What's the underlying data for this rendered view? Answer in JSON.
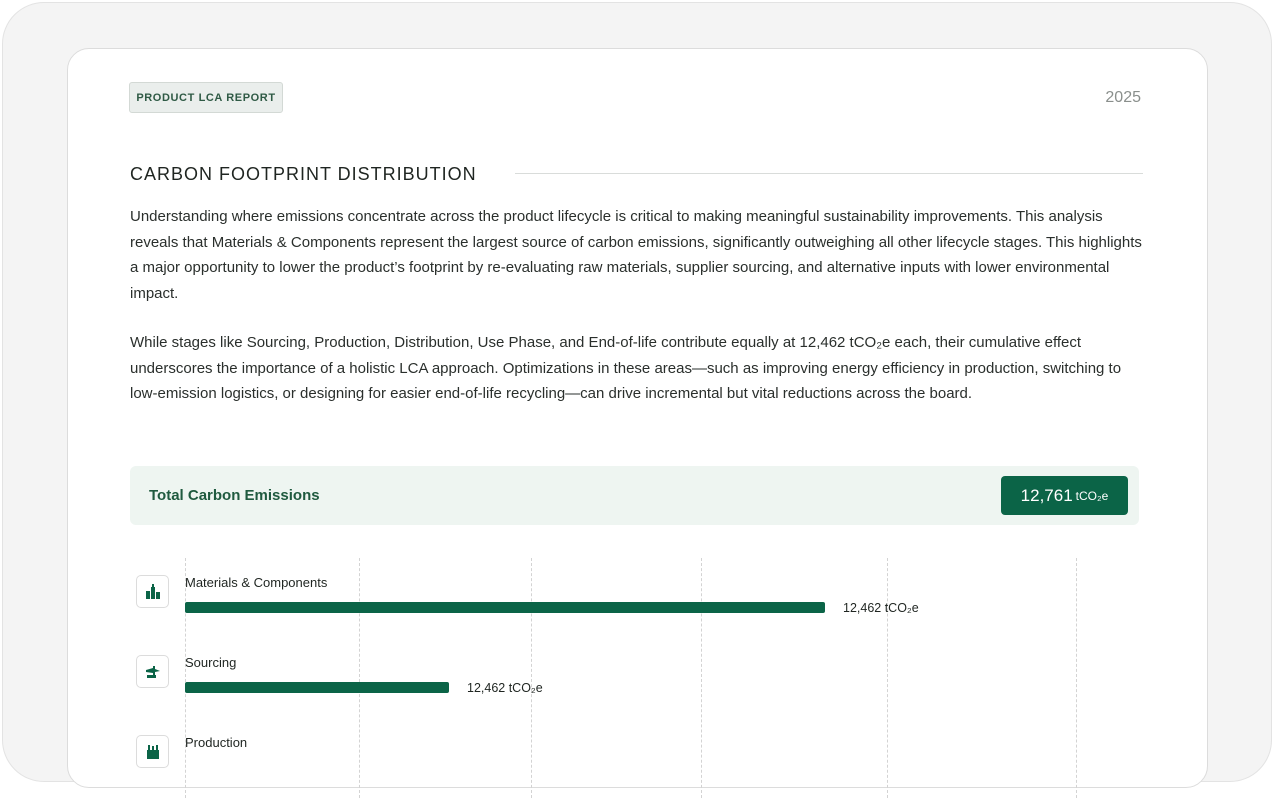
{
  "header": {
    "badge": "PRODUCT LCA REPORT",
    "year": "2025"
  },
  "section": {
    "title": "CARBON FOOTPRINT DISTRIBUTION",
    "paragraphs": [
      "Understanding where emissions concentrate across the product lifecycle is critical to making meaningful sustainability improvements. This analysis reveals that Materials & Components represent the largest source of carbon emissions, significantly outweighing all other lifecycle stages. This highlights a major opportunity to lower the product’s footprint by re-evaluating raw materials, supplier sourcing, and alternative inputs with lower environmental impact.",
      "While stages like Sourcing, Production, Distribution, Use Phase, and End-of-life contribute equally at 12,462 tCO₂e each, their cumulative effect underscores the importance of a holistic LCA approach. Optimizations in these areas—such as improving energy efficiency in production, switching to low-emission logistics, or designing for easier end-of-life recycling—can drive incremental but vital reductions across the board."
    ]
  },
  "total": {
    "label": "Total Carbon Emissions",
    "value": "12,761",
    "unit": "tCO₂e"
  },
  "chart_data": {
    "type": "bar",
    "orientation": "horizontal",
    "categories": [
      "Materials & Components",
      "Sourcing",
      "Production"
    ],
    "value_labels": [
      "12,462 tCO₂e",
      "12,462 tCO₂e",
      ""
    ],
    "relative_lengths": [
      1.0,
      0.413,
      null
    ],
    "icons": [
      "factory-icon",
      "plane-truck-icon",
      "production-icon"
    ],
    "grid": true,
    "colors": {
      "bar": "#0b6447"
    }
  }
}
